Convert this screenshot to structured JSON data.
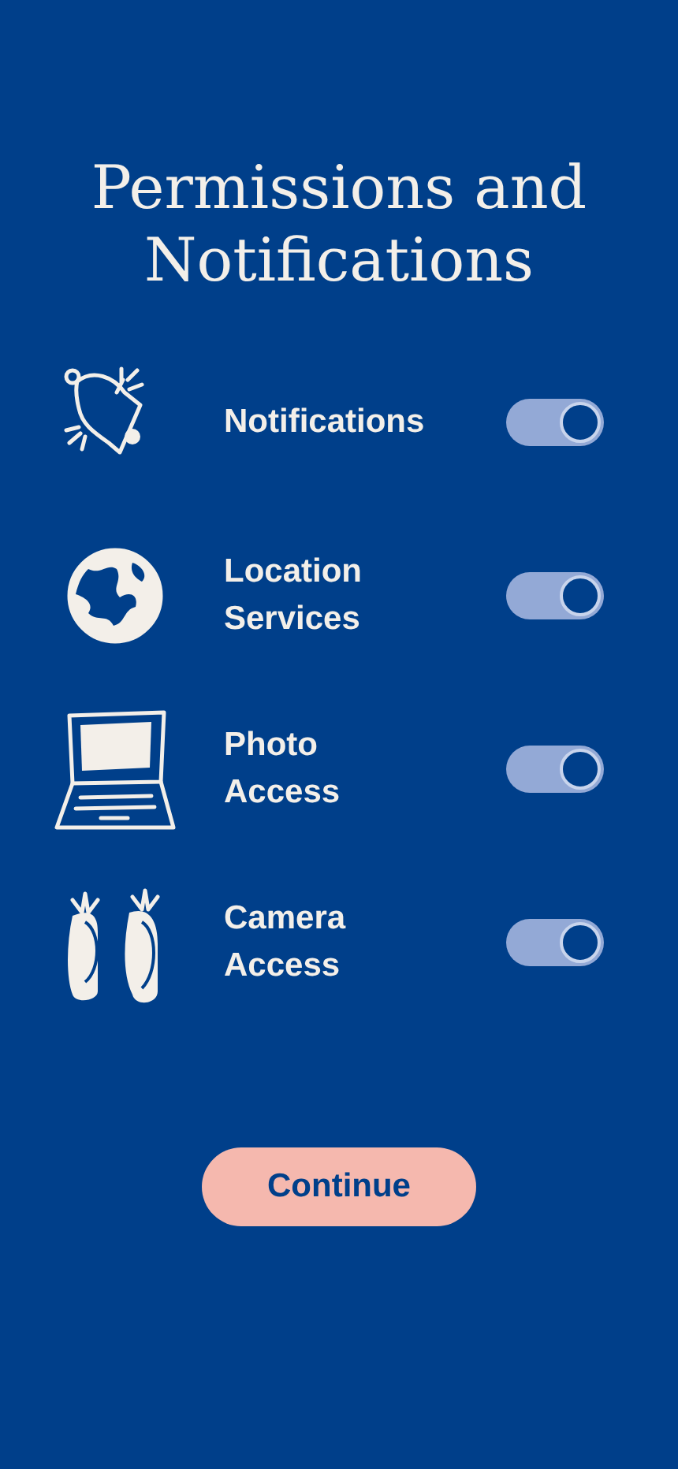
{
  "title": "Permissions and Notifications",
  "permissions": [
    {
      "label": [
        "Notifications"
      ],
      "on": true
    },
    {
      "label": [
        "Location",
        "Services"
      ],
      "on": true
    },
    {
      "label": [
        "Photo",
        "Access"
      ],
      "on": true
    },
    {
      "label": [
        "Camera",
        "Access"
      ],
      "on": true
    }
  ],
  "continue_button": "Continue"
}
